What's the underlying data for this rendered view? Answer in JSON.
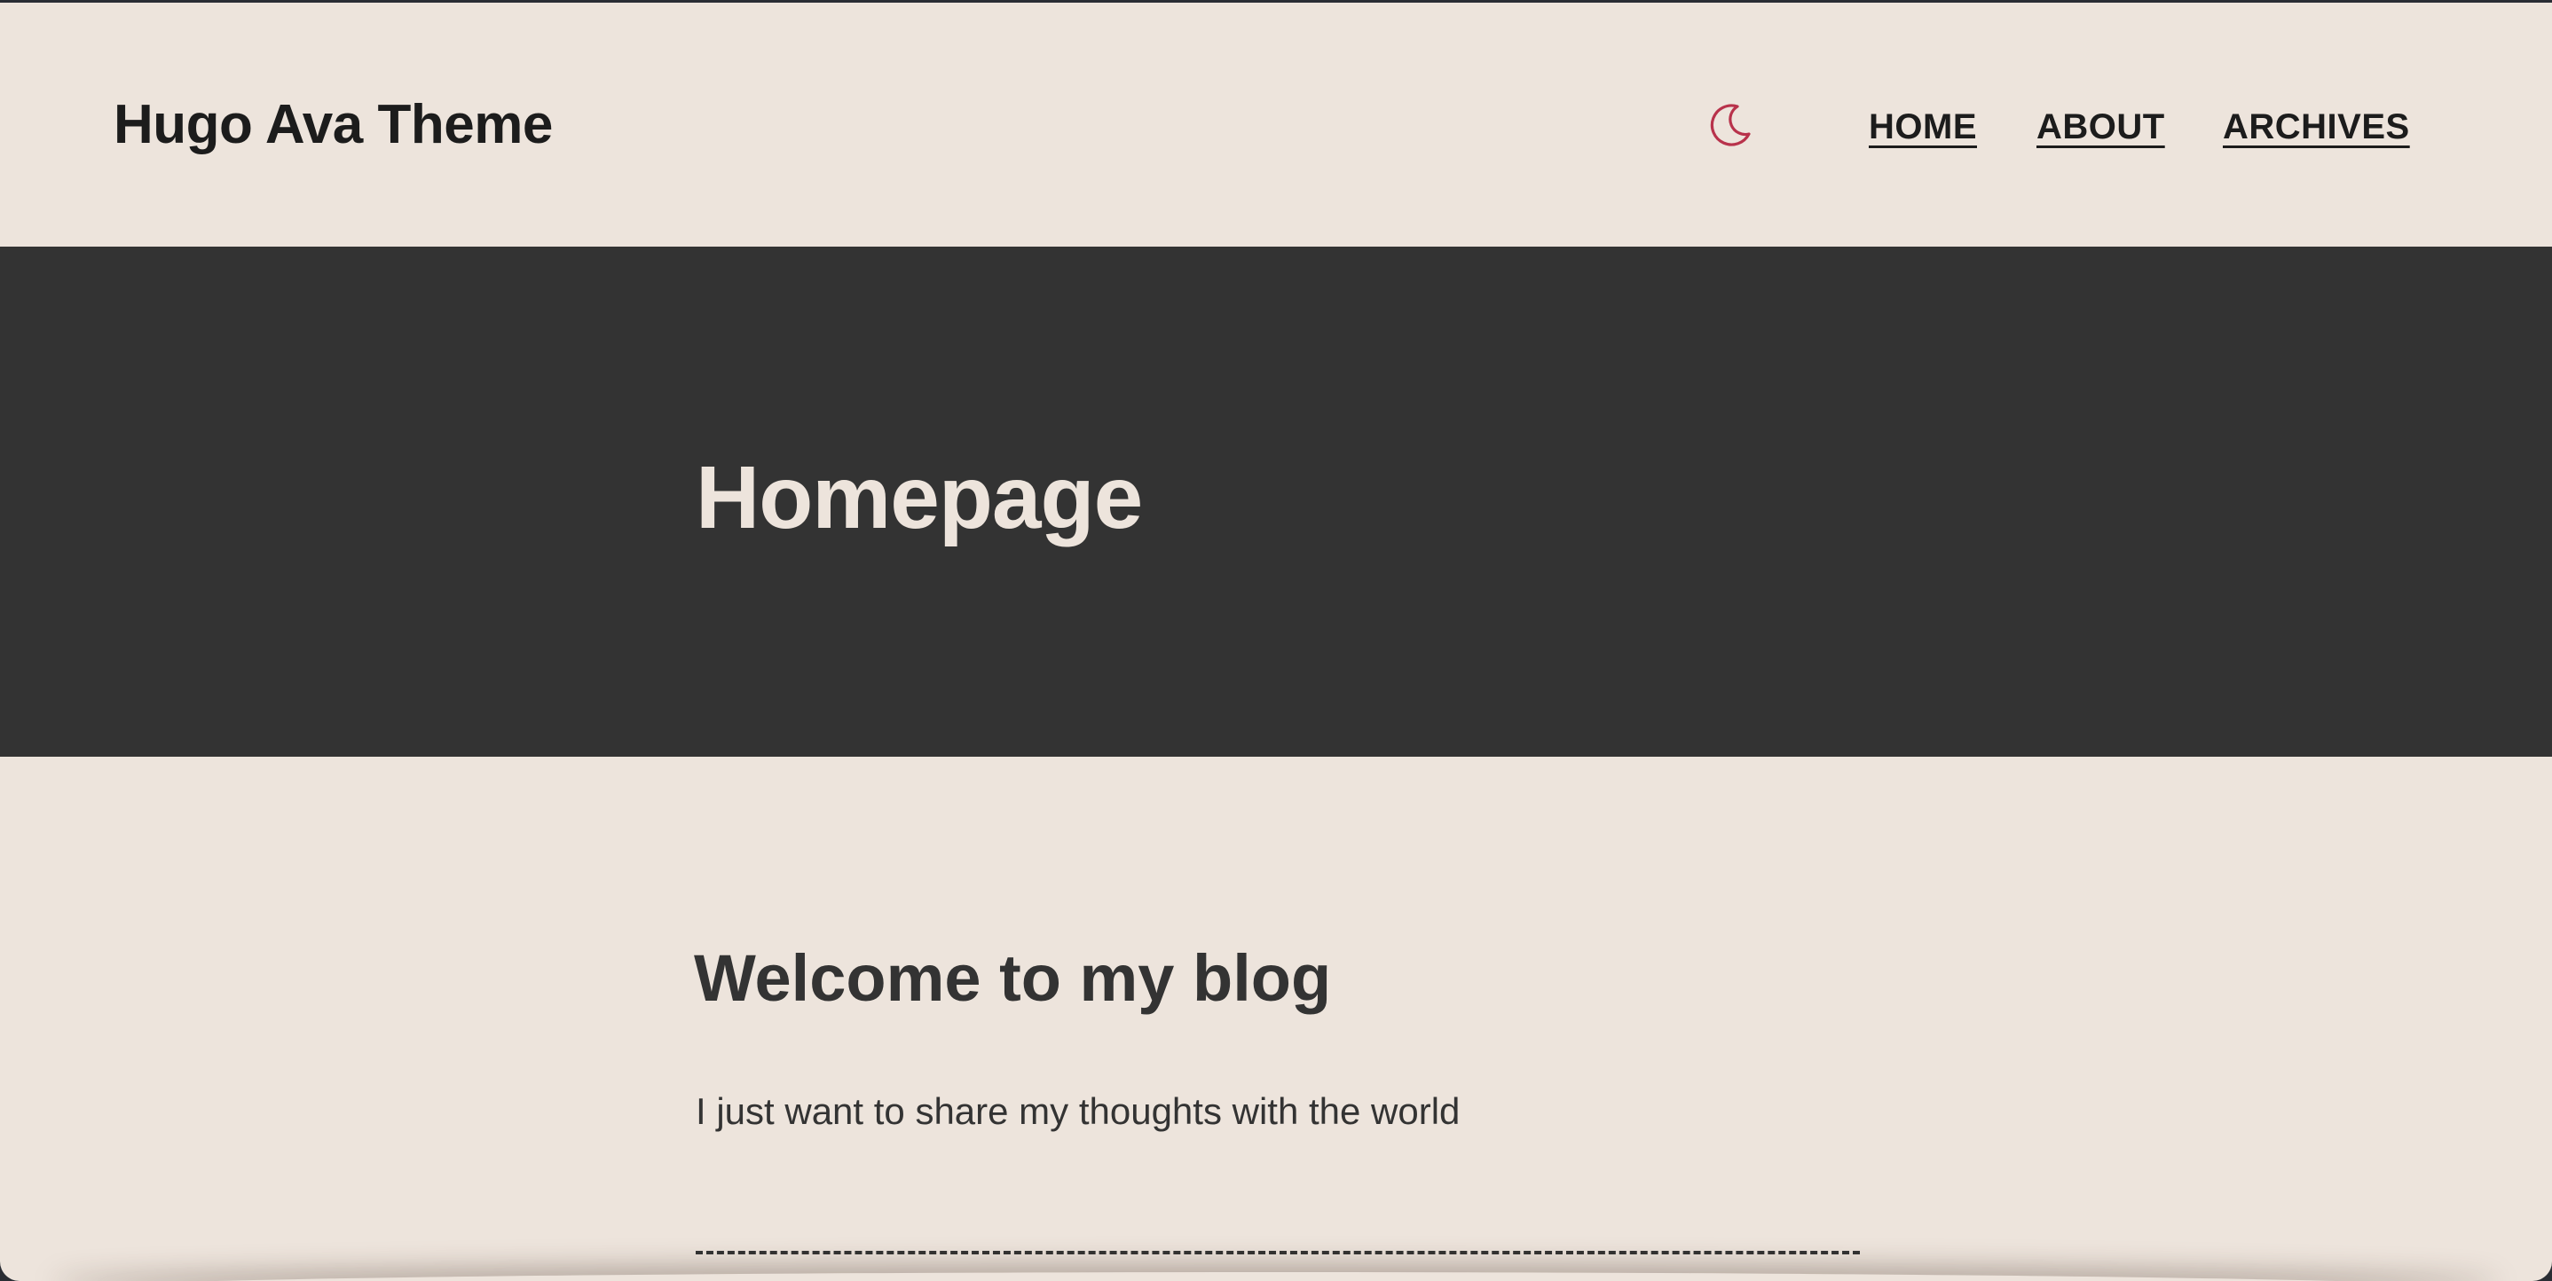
{
  "header": {
    "site_title": "Hugo Ava Theme",
    "theme_toggle_icon": "moon-icon",
    "accent_color": "#b8324b",
    "nav": [
      {
        "label": "HOME"
      },
      {
        "label": "ABOUT"
      },
      {
        "label": "ARCHIVES"
      }
    ]
  },
  "hero": {
    "title": "Homepage",
    "background": "#333333"
  },
  "main": {
    "heading": "Welcome to my blog",
    "intro": "I just want to share my thoughts with the world"
  },
  "colors": {
    "page_background": "#ede4dc",
    "text": "#333333"
  }
}
